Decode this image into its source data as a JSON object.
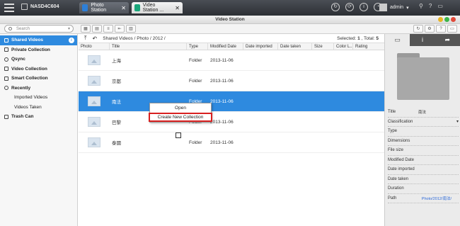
{
  "topbar": {
    "nas_name": "NASD4C604",
    "tabs": [
      {
        "label": "Photo Station"
      },
      {
        "label": "Video Station ..."
      }
    ],
    "user": "admin"
  },
  "window": {
    "title": "Video Station"
  },
  "search": {
    "placeholder": "Search"
  },
  "sidebar": {
    "items": [
      {
        "label": "Shared Videos",
        "badge": "i",
        "active": true
      },
      {
        "label": "Private Collection"
      },
      {
        "label": "Qsync"
      },
      {
        "label": "Video Collection"
      },
      {
        "label": "Smart Collection"
      },
      {
        "label": "Recently"
      },
      {
        "label": "Imported Videos",
        "sub": true
      },
      {
        "label": "Videos Taken",
        "sub": true
      },
      {
        "label": "Trash Can"
      }
    ]
  },
  "pathbar": {
    "path": "Shared Videos / Photo / 2012 /",
    "selected_label": "Selected:",
    "selected": "1",
    "total_label": "Total:",
    "total": "5"
  },
  "table": {
    "columns": [
      "Photo",
      "Title",
      "Type",
      "Modified Date",
      "Date imported",
      "Date taken",
      "Size",
      "Color L...",
      "Rating"
    ],
    "rows": [
      {
        "title": "上海",
        "type": "Folder",
        "modified": "2013-11-06"
      },
      {
        "title": "京都",
        "type": "Folder",
        "modified": "2013-11-06"
      },
      {
        "title": "南法",
        "type": "Folder",
        "modified": "2013-11-06",
        "selected": true
      },
      {
        "title": "巴黎",
        "type": "Folder",
        "modified": "2013-11-06"
      },
      {
        "title": "泰國",
        "type": "Folder",
        "modified": "2013-11-06"
      }
    ]
  },
  "context_menu": {
    "items": [
      "Open",
      "Create New Collection"
    ]
  },
  "details": {
    "props": [
      {
        "k": "Title",
        "v": "南法"
      },
      {
        "k": "Classification",
        "v": ""
      },
      {
        "k": "Type",
        "v": ""
      },
      {
        "k": "Dimensions",
        "v": ""
      },
      {
        "k": "File size",
        "v": ""
      },
      {
        "k": "Modified Date",
        "v": ""
      },
      {
        "k": "Date imported",
        "v": ""
      },
      {
        "k": "Date taken",
        "v": ""
      },
      {
        "k": "Duration",
        "v": ""
      },
      {
        "k": "Path",
        "v": "Photo/2012/南法/"
      }
    ]
  },
  "colors": {
    "accent": "#2e8adf",
    "highlight": "#d82020"
  }
}
